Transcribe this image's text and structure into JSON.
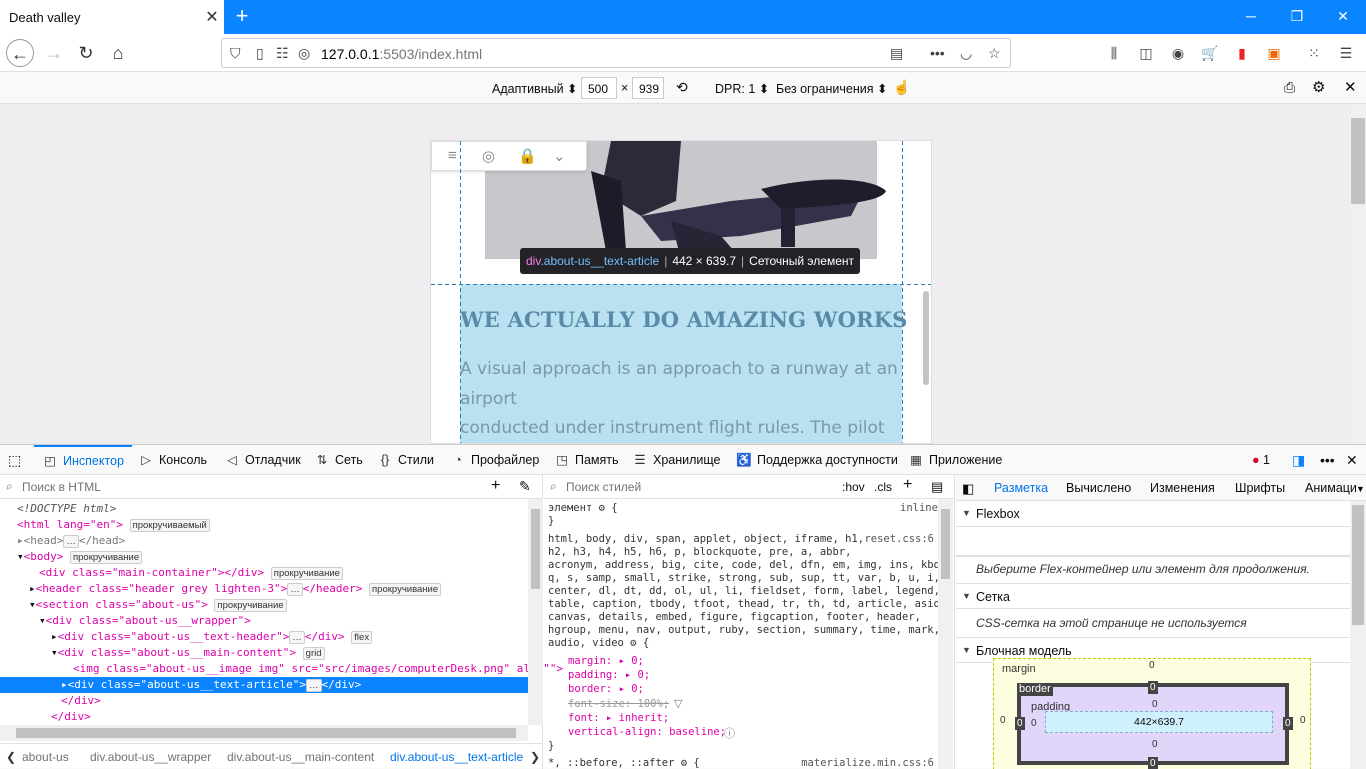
{
  "browser": {
    "tab_title": "Death valley",
    "url_prefix": "127.0.0.1",
    "url_rest": ":5503/index.html",
    "accent": "#0a84ff"
  },
  "rdm": {
    "device": "Адаптивный ⬍",
    "width": "500",
    "times": "×",
    "height": "939",
    "dpr": "DPR: 1 ⬍",
    "throttle": "Без ограничения ⬍"
  },
  "page": {
    "heading": "WE ACTUALLY DO AMAZING WORKS",
    "para1": "A visual approach is an approach to a runway at an",
    "para2": "airport",
    "para3": "conducted under instrument flight rules. The pilot"
  },
  "tooltip": {
    "tag": "div",
    "cls": ".about-us__text-article",
    "size": "442 × 639.7",
    "kind": "Сеточный элемент"
  },
  "devtools": {
    "tabs": [
      "Инспектор",
      "Консоль",
      "Отладчик",
      "Сеть",
      "Стили",
      "Профайлер",
      "Память",
      "Хранилище",
      "Поддержка доступности",
      "Приложение"
    ],
    "errors": "1",
    "html_search": "Поиск в HTML",
    "style_search": "Поиск стилей",
    "hov": ":hov",
    "cls": ".cls",
    "breadcrumbs": [
      "about-us",
      "div.about-us__wrapper",
      "div.about-us__main-content",
      "div.about-us__text-article"
    ]
  },
  "markup": {
    "l1": "<!DOCTYPE html>",
    "l2": "<html lang=\"en\">",
    "l2b": "прокручиваемый",
    "l3": "<head>",
    "l3b": "</head>",
    "l4": "<body>",
    "l4b": "прокручивание",
    "l5": "<div class=\"main-container\"></div>",
    "l5b": "прокручивание",
    "l6": "<header class=\"header grey lighten-3\">",
    "l6e": "</header>",
    "l6b": "прокручивание",
    "l7": "<section class=\"about-us\">",
    "l7b": "прокручивание",
    "l8": "<div class=\"about-us__wrapper\">",
    "l9": "<div class=\"about-us__text-header\">",
    "l9e": "</div>",
    "l9b": "flex",
    "l10": "<div class=\"about-us__main-content\">",
    "l10b": "grid",
    "l11": "<img class=\"about-us__image img\" src=\"src/images/computerDesk.png\" alt=\"\">",
    "l12": "<div class=\"about-us__text-article\">",
    "l12e": "</div>",
    "l13": "</div>",
    "l14": "</div>"
  },
  "rules": {
    "el": "элемент",
    "el_open": " {",
    "inline": "inline",
    "close": "}",
    "sel1": "html, body, div, span, applet, object, iframe, h1,",
    "sel2": "h2, h3, h4, h5, h6, p, blockquote, pre, a, abbr,",
    "sel3": "acronym, address, big, cite, code, del, dfn, em, img, ins, kbd,",
    "sel4": "q, s, samp, small, strike, strong, sub, sup, tt, var, b, u, i,",
    "sel5": "center, dl, dt, dd, ol, ul, li, fieldset, form, label, legend,",
    "sel6": "table, caption, tbody, tfoot, thead, tr, th, td, article, aside,",
    "sel7": "canvas, details, embed, figure, figcaption, footer, header,",
    "sel8": "hgroup, menu, nav, output, ruby, section, summary, time, mark,",
    "sel9": "audio, video",
    "src1": "reset.css:6",
    "p1": "margin: ▸ 0;",
    "p2": "padding: ▸ 0;",
    "p3": "border: ▸ 0;",
    "p4": "font-size: 100%;",
    "p5": "font: ▸ inherit;",
    "p6": "vertical-align: baseline;",
    "next": "*, ::before, ::after",
    "src2": "materialize.min.css:6"
  },
  "layout": {
    "tabs": [
      "Разметка",
      "Вычислено",
      "Изменения",
      "Шрифты",
      "Анимаци"
    ],
    "flex": "Flexbox",
    "flex_info": "Выберите Flex-контейнер или элемент для продолжения.",
    "grid": "Сетка",
    "grid_info": "CSS-сетка на этой странице не используется",
    "boxmodel": "Блочная модель",
    "margin_label": "margin",
    "border_label": "border",
    "padding_label": "padding",
    "content": "442×639.7",
    "zero": "0"
  }
}
